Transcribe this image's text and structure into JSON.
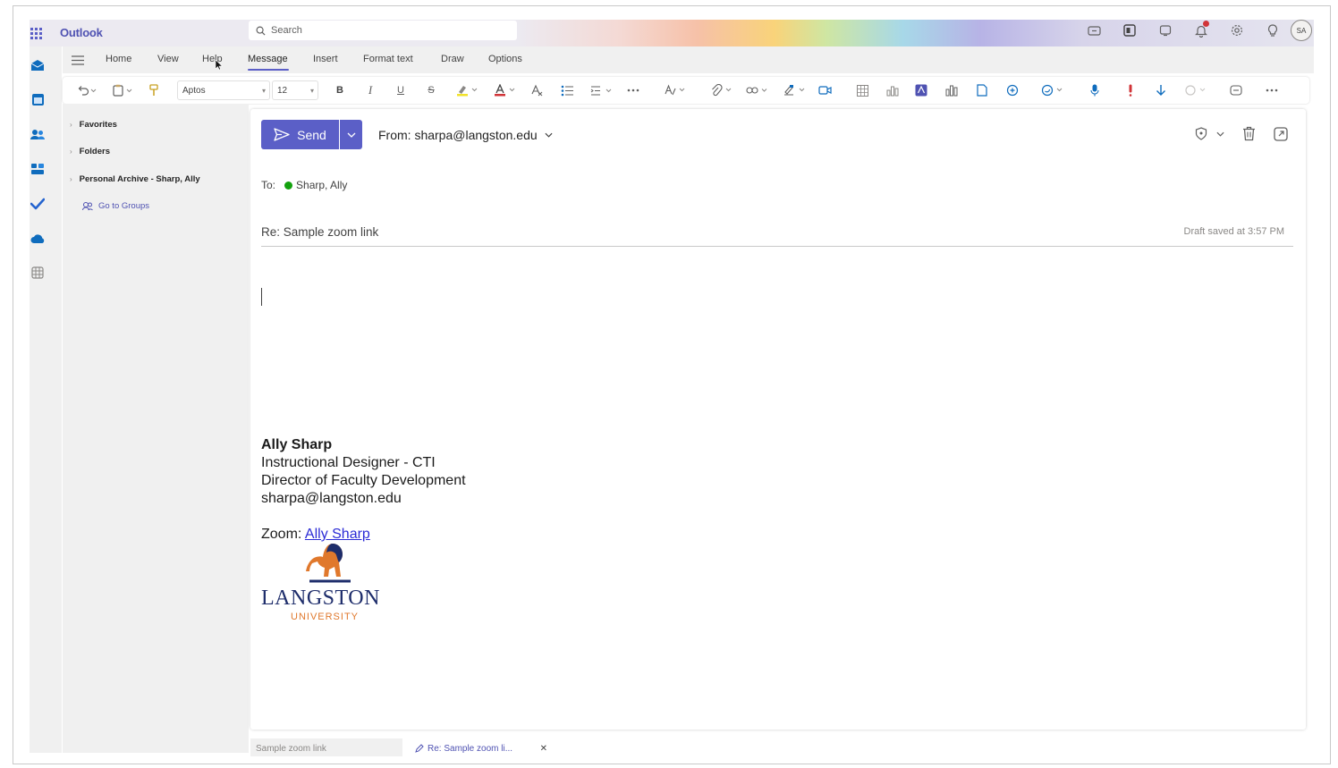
{
  "app": {
    "title": "Outlook"
  },
  "search": {
    "placeholder": "Search"
  },
  "header": {
    "avatar_initials": "SA"
  },
  "tabs": [
    {
      "label": "Home"
    },
    {
      "label": "View"
    },
    {
      "label": "Help"
    },
    {
      "label": "Message"
    },
    {
      "label": "Insert"
    },
    {
      "label": "Format text"
    },
    {
      "label": "Draw"
    },
    {
      "label": "Options"
    }
  ],
  "ribbon": {
    "font_name": "Aptos",
    "font_size": "12",
    "bold": "B",
    "italic": "I",
    "underline": "U",
    "strike": "S"
  },
  "nav": {
    "items": [
      {
        "label": "Favorites"
      },
      {
        "label": "Folders"
      },
      {
        "label": "Personal Archive - Sharp, Ally"
      }
    ],
    "groups_link": "Go to Groups"
  },
  "compose": {
    "send_label": "Send",
    "from_label": "From: sharpa@langston.edu",
    "to_label": "To:",
    "recipient": "Sharp, Ally",
    "subject": "Re: Sample zoom link",
    "draft_status": "Draft saved at 3:57 PM"
  },
  "signature": {
    "name": "Ally Sharp",
    "title1": "Instructional Designer - CTI",
    "title2": "Director of Faculty Development",
    "email": "sharpa@langston.edu",
    "zoom_prefix": "Zoom: ",
    "zoom_link": "Ally Sharp",
    "logo_word": "LANGSTON",
    "logo_sub": "UNIVERSITY"
  },
  "bottom_tabs": [
    {
      "label": "Sample zoom link"
    },
    {
      "label": "Re: Sample zoom li..."
    }
  ],
  "colors": {
    "accent": "#5b5fc7",
    "link": "#2b2bd6",
    "logo_navy": "#1e2d6b",
    "logo_orange": "#e0782c"
  }
}
